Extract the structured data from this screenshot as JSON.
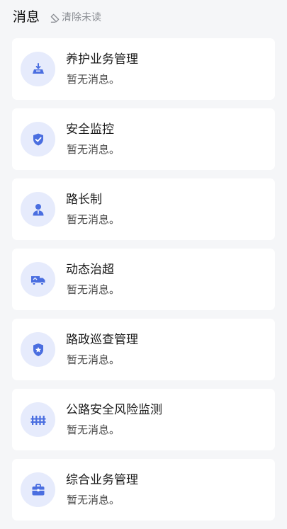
{
  "header": {
    "title": "消息",
    "clear_label": "清除未读",
    "clear_icon": "clear-unread-icon"
  },
  "colors": {
    "accent": "#4a6ee0",
    "icon_bg": "#e6ebfc",
    "page_bg": "#f5f6f8"
  },
  "messages": [
    {
      "title": "养护业务管理",
      "subtitle": "暂无消息。",
      "icon": "maintenance-icon"
    },
    {
      "title": "安全监控",
      "subtitle": "暂无消息。",
      "icon": "shield-check-icon"
    },
    {
      "title": "路长制",
      "subtitle": "暂无消息。",
      "icon": "person-icon"
    },
    {
      "title": "动态治超",
      "subtitle": "暂无消息。",
      "icon": "truck-icon"
    },
    {
      "title": "路政巡查管理",
      "subtitle": "暂无消息。",
      "icon": "badge-star-icon"
    },
    {
      "title": "公路安全风险监测",
      "subtitle": "暂无消息。",
      "icon": "guardrail-icon"
    },
    {
      "title": "综合业务管理",
      "subtitle": "暂无消息。",
      "icon": "briefcase-icon"
    }
  ]
}
